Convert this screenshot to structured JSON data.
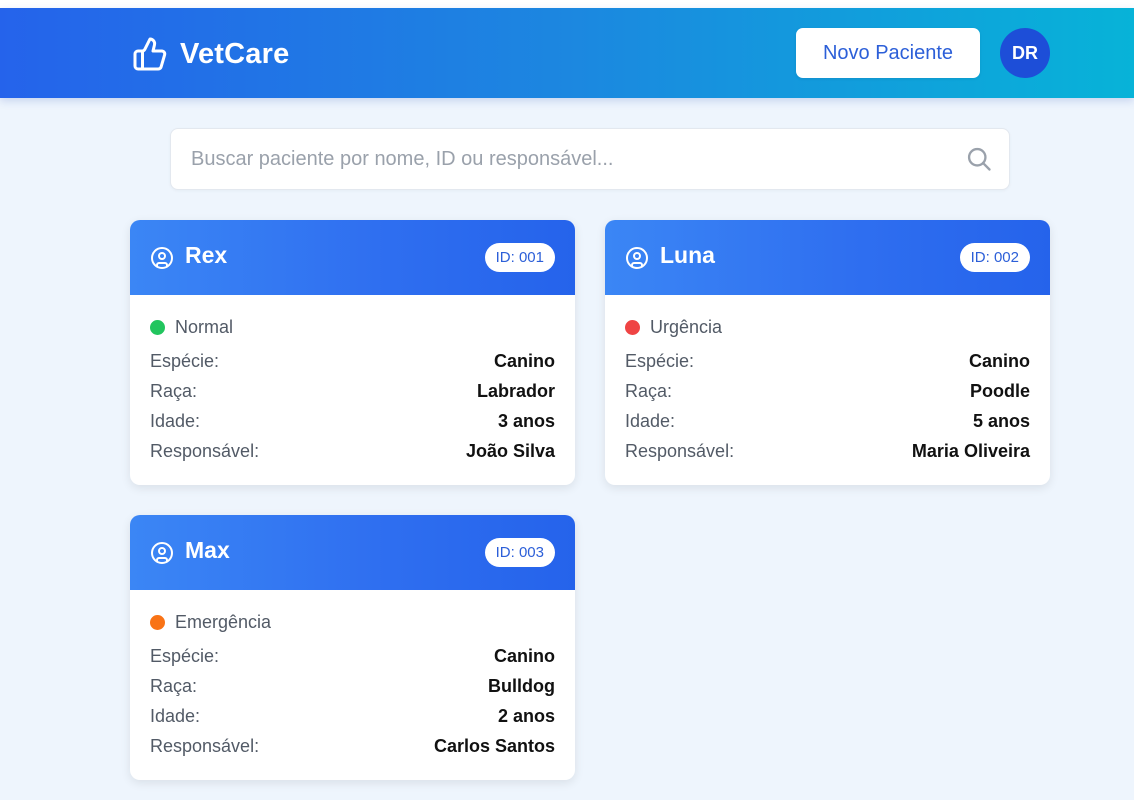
{
  "app": {
    "name": "VetCare",
    "logo_icon": "thumbs-up-icon"
  },
  "header": {
    "new_patient_label": "Novo Paciente",
    "avatar_initials": "DR"
  },
  "search": {
    "placeholder": "Buscar paciente por nome, ID ou responsável...",
    "value": ""
  },
  "field_labels": {
    "species": "Espécie:",
    "breed": "Raça:",
    "age": "Idade:",
    "owner": "Responsável:"
  },
  "patients": [
    {
      "name": "Rex",
      "id_label": "ID: 001",
      "status": "Normal",
      "status_color": "#22c55e",
      "species": "Canino",
      "breed": "Labrador",
      "age": "3 anos",
      "owner": "João Silva"
    },
    {
      "name": "Luna",
      "id_label": "ID: 002",
      "status": "Urgência",
      "status_color": "#ef4444",
      "species": "Canino",
      "breed": "Poodle",
      "age": "5 anos",
      "owner": "Maria Oliveira"
    },
    {
      "name": "Max",
      "id_label": "ID: 003",
      "status": "Emergência",
      "status_color": "#f97316",
      "species": "Canino",
      "breed": "Bulldog",
      "age": "2 anos",
      "owner": "Carlos Santos"
    }
  ],
  "colors": {
    "primary": "#2563eb",
    "accent": "#07b3d8",
    "page_bg": "#eef5fd"
  }
}
